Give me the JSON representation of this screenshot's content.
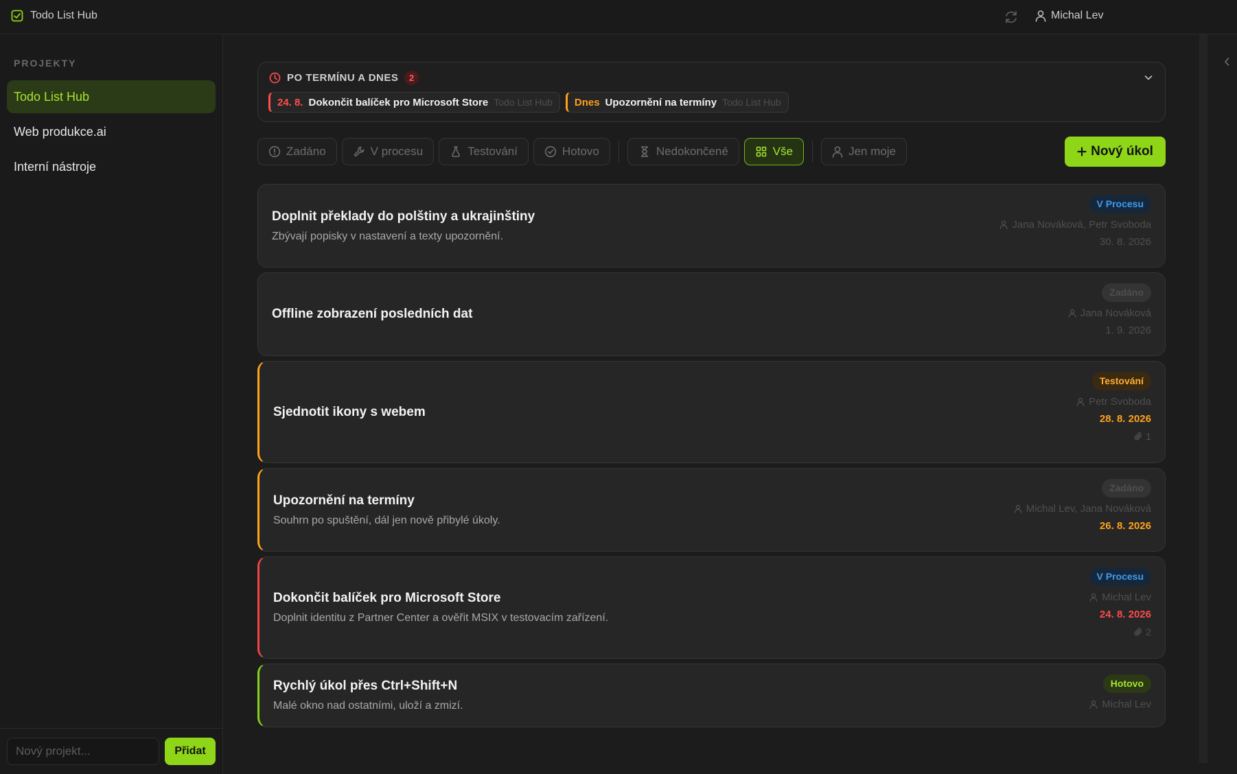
{
  "app": {
    "title": "Todo List Hub",
    "user": "Michal Lev"
  },
  "sidebar": {
    "heading": "PROJEKTY",
    "projects": [
      {
        "label": "Todo List Hub"
      },
      {
        "label": "Web produkce.ai"
      },
      {
        "label": "Interní nástroje"
      }
    ],
    "new_project_placeholder": "Nový projekt...",
    "add_label": "Přidat"
  },
  "overdue": {
    "title": "PO TERMÍNU A DNES",
    "count": "2",
    "items": [
      {
        "date": "24. 8.",
        "title": "Dokončit balíček pro Microsoft Store",
        "project": "Todo List Hub",
        "color": "#ff4d4d"
      },
      {
        "date": "Dnes",
        "title": "Upozornění na termíny",
        "project": "Todo List Hub",
        "color": "#ff9f1c"
      }
    ]
  },
  "filters": {
    "zadano": "Zadáno",
    "vprocesu": "V procesu",
    "testovani": "Testování",
    "hotovo": "Hotovo",
    "nedokoncene": "Nedokončené",
    "vse": "Vše",
    "jenmoje": "Jen moje",
    "active": "Vše"
  },
  "new_task_label": "Nový úkol",
  "tasks": [
    {
      "title": "Doplnit překlady do polštiny a ukrajinštiny",
      "desc": "Zbývají popisky v nastavení a texty upozornění.",
      "status": "V Procesu",
      "assignees": "Jana Nováková, Petr Svoboda",
      "date": "30. 8. 2026",
      "attachments": ""
    },
    {
      "title": "Offline zobrazení posledních dat",
      "desc": "",
      "status": "Zadáno",
      "assignees": "Jana Nováková",
      "date": "1. 9. 2026",
      "attachments": ""
    },
    {
      "title": "Sjednotit ikony s webem",
      "desc": "",
      "status": "Testování",
      "assignees": "Petr Svoboda",
      "date": "28. 8. 2026",
      "attachments": "1"
    },
    {
      "title": "Upozornění na termíny",
      "desc": "Souhrn po spuštění, dál jen nově přibylé úkoly.",
      "status": "Zadáno",
      "assignees": "Michal Lev, Jana Nováková",
      "date": "26. 8. 2026",
      "attachments": ""
    },
    {
      "title": "Dokončit balíček pro Microsoft Store",
      "desc": "Doplnit identitu z Partner Center a ověřit MSIX v testovacím zařízení.",
      "status": "V Procesu",
      "assignees": "Michal Lev",
      "date": "24. 8. 2026",
      "attachments": "2"
    },
    {
      "title": "Rychlý úkol přes Ctrl+Shift+N",
      "desc": "Malé okno nad ostatními, uloží a zmizí.",
      "status": "Hotovo",
      "assignees": "Michal Lev",
      "date": "",
      "attachments": ""
    }
  ],
  "colors": {
    "accent": "#8fd619",
    "overdue_red": "#ff4a4a",
    "due_orange": "#ffa31a",
    "in_progress_blue": "#3b9cf5"
  },
  "icons": {
    "app": "checkbox-icon",
    "refresh": "refresh-icon",
    "user": "user-icon",
    "overdue": "clock-icon",
    "collapse": "chevron-down-icon",
    "sidebar_collapse": "chevron-left-icon",
    "attachment": "paperclip-icon"
  }
}
